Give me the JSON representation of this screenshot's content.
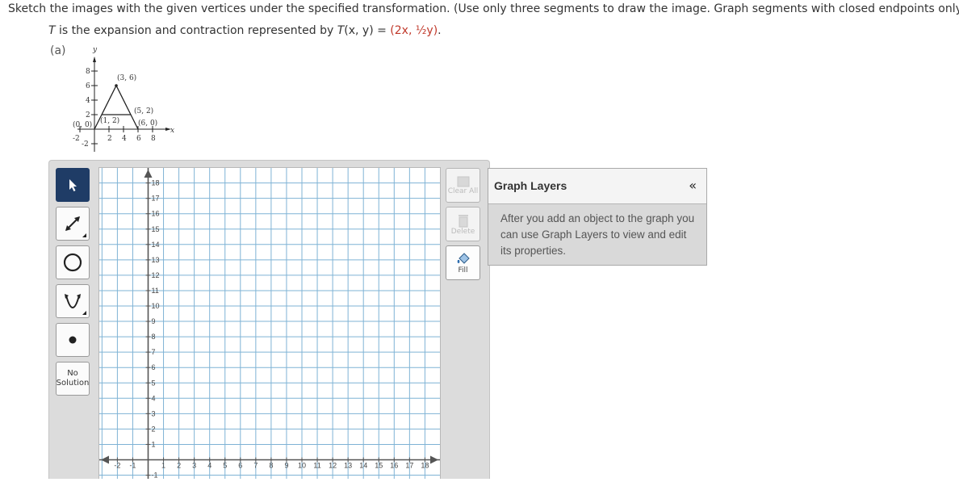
{
  "question": {
    "instruction": "Sketch the images with the given vertices under the specified transformation. (Use only three segments to draw the image. Graph segments with closed endpoints only.)",
    "transform_prefix_T": "T",
    "transform_mid": " is the expansion and contraction represented by ",
    "transform_func": "T",
    "transform_args": "(x, y) = ",
    "transform_rule": "(2x, ½y)",
    "transform_end": ".",
    "part_label": "(a)"
  },
  "reference_graph": {
    "axis_y_label": "y",
    "axis_x_label": "x",
    "y_ticks": [
      "8",
      "6",
      "4",
      "2",
      "-2"
    ],
    "x_ticks": [
      "-2",
      "2",
      "4",
      "6",
      "8"
    ],
    "vertices": [
      "(3, 6)",
      "(5, 2)",
      "(1, 2)",
      "(0, 0)",
      "(6, 0)"
    ]
  },
  "tools": [
    {
      "name": "select",
      "icon": "arrow-pointer-icon",
      "active": true
    },
    {
      "name": "line",
      "icon": "line-segment-icon",
      "active": false
    },
    {
      "name": "circle",
      "icon": "circle-icon",
      "active": false
    },
    {
      "name": "parabola",
      "icon": "parabola-icon",
      "active": false
    },
    {
      "name": "point",
      "icon": "point-icon",
      "active": false
    }
  ],
  "no_solution_label_line1": "No",
  "no_solution_label_line2": "Solution",
  "side_buttons": {
    "clear_all": "Clear All",
    "delete": "Delete",
    "fill": "Fill"
  },
  "graph": {
    "x_tick_labels": [
      "-2",
      "-1",
      "1",
      "2",
      "3",
      "4",
      "5",
      "6",
      "7",
      "8",
      "9",
      "10",
      "11",
      "12",
      "13",
      "14",
      "15",
      "16",
      "17",
      "18"
    ],
    "y_tick_labels": [
      "18",
      "17",
      "16",
      "15",
      "14",
      "13",
      "12",
      "11",
      "10",
      "9",
      "8",
      "7",
      "6",
      "5",
      "4",
      "3",
      "2",
      "1",
      "-1"
    ]
  },
  "layers_panel": {
    "title": "Graph Layers",
    "collapse_symbol": "«",
    "message": "After you add an object to the graph you can use Graph Layers to view and edit its properties."
  },
  "colors": {
    "active_tool": "#1f3c66",
    "grid_line": "#7fb3d5",
    "highlight_red": "#c0392b"
  }
}
